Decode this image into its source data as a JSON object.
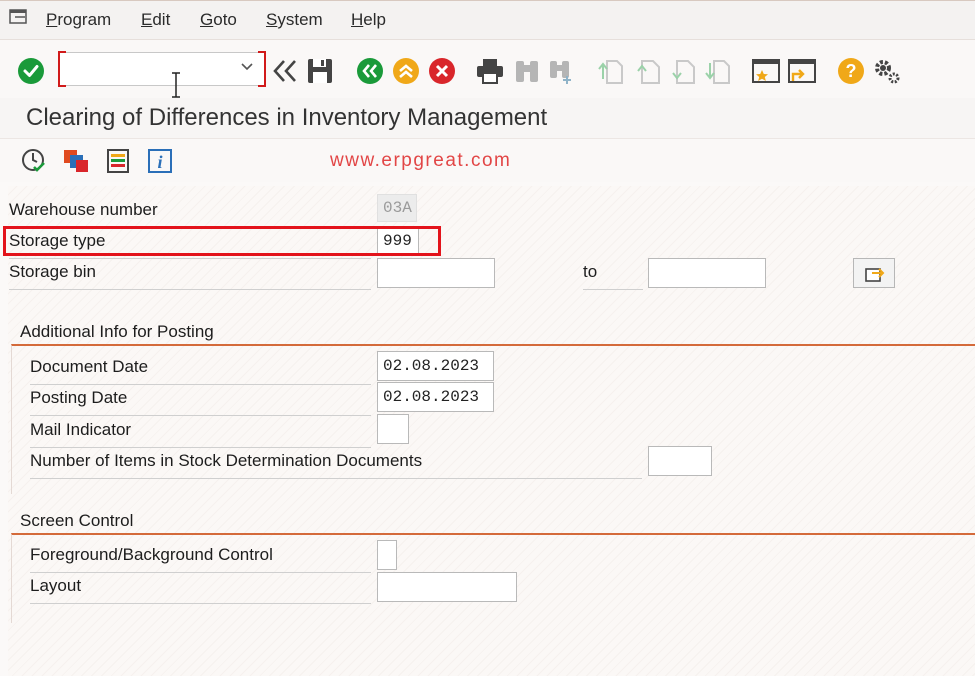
{
  "menubar": {
    "items": [
      {
        "label": "Program"
      },
      {
        "label": "Edit"
      },
      {
        "label": "Goto"
      },
      {
        "label": "System"
      },
      {
        "label": "Help"
      }
    ]
  },
  "toolbar": {
    "command_field_value": "",
    "icons": [
      "enter-icon",
      "back-double-icon",
      "save-icon",
      "back-icon",
      "exit-icon",
      "cancel-icon",
      "print-icon",
      "find-icon",
      "find-next-icon",
      "first-page-icon",
      "previous-page-icon",
      "next-page-icon",
      "last-page-icon",
      "create-session-icon",
      "shortcut-icon",
      "help-icon",
      "settings-icon"
    ]
  },
  "page": {
    "title": "Clearing of Differences in Inventory Management"
  },
  "watermark": "www.erpgreat.com",
  "selection": {
    "warehouse_label": "Warehouse number",
    "warehouse_value": "03A",
    "storage_type_label": "Storage type",
    "storage_type_value": "999",
    "storage_bin_label": "Storage bin",
    "storage_bin_from": "",
    "to_label": "to",
    "storage_bin_to": ""
  },
  "posting": {
    "group_title": "Additional Info for Posting",
    "document_date_label": "Document Date",
    "document_date_value": "02.08.2023",
    "posting_date_label": "Posting Date",
    "posting_date_value": "02.08.2023",
    "mail_indicator_label": "Mail Indicator",
    "mail_indicator_value": "",
    "num_items_label": "Number of Items in Stock Determination Documents",
    "num_items_value": ""
  },
  "screen_control": {
    "group_title": "Screen Control",
    "fg_bg_label": "Foreground/Background Control",
    "fg_bg_value": "",
    "layout_label": "Layout",
    "layout_value": ""
  },
  "colors": {
    "accent": "#d46a3a",
    "highlight": "#e3131b",
    "watermark": "#e24646",
    "green": "#1a9a3a",
    "orange": "#f0a818",
    "red": "#d9262b"
  }
}
